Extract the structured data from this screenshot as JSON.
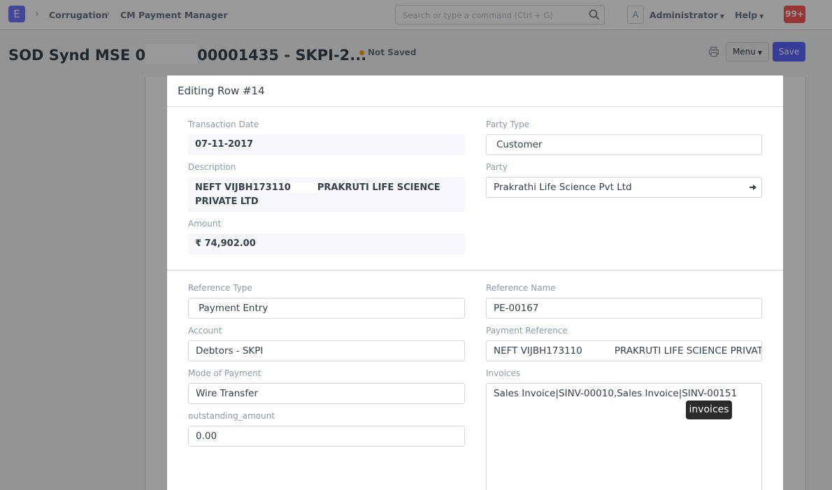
{
  "navbar": {
    "logo": "E",
    "breadcrumbs": [
      "Corrugation",
      "CM Payment Manager"
    ],
    "search_placeholder": "Search or type a command (Ctrl + G)",
    "avatar_letter": "A",
    "user": "Administrator",
    "help": "Help",
    "notifications": "99+"
  },
  "page": {
    "title_prefix": "SOD Synd MSE 0",
    "title_suffix": "00001435 - SKPI-2...",
    "status": "Not Saved",
    "menu_label": "Menu",
    "save_label": "Save"
  },
  "form": {
    "title": "Editing Row #14",
    "transaction_date": {
      "label": "Transaction Date",
      "value": "07-11-2017"
    },
    "description": {
      "label": "Description",
      "line1_start": "NEFT VIJBH173110",
      "line1_end": "PRAKRUTI LIFE SCIENCE",
      "line2": "PRIVATE LTD"
    },
    "amount": {
      "label": "Amount",
      "value": "₹ 74,902.00"
    },
    "party_type": {
      "label": "Party Type",
      "value": "Customer"
    },
    "party": {
      "label": "Party",
      "value": "Prakrathi Life Science Pvt Ltd"
    },
    "reference_type": {
      "label": "Reference Type",
      "value": "Payment Entry"
    },
    "reference_name": {
      "label": "Reference Name",
      "value": "PE-00167"
    },
    "account": {
      "label": "Account",
      "value": "Debtors - SKPI"
    },
    "payment_reference": {
      "label": "Payment Reference",
      "value_start": "NEFT VIJBH173110",
      "value_end": "PRAKRUTI LIFE SCIENCE PRIVATE"
    },
    "mode_of_payment": {
      "label": "Mode of Payment",
      "value": "Wire Transfer"
    },
    "invoices": {
      "label": "Invoices",
      "value": "Sales Invoice|SINV-00010,Sales Invoice|SINV-00151"
    },
    "outstanding_amount": {
      "label": "outstanding_amount",
      "value": "0.00"
    }
  },
  "tooltip": "invoices",
  "colors": {
    "accent": "#5e64ff",
    "logo": "#7575ff",
    "notification": "#ff5858",
    "unsaved_indicator": "#ffa00a"
  },
  "icons": [
    "search-icon",
    "printer-icon",
    "arrow-right-icon",
    "chevron-right-icon",
    "caret-down-icon"
  ]
}
